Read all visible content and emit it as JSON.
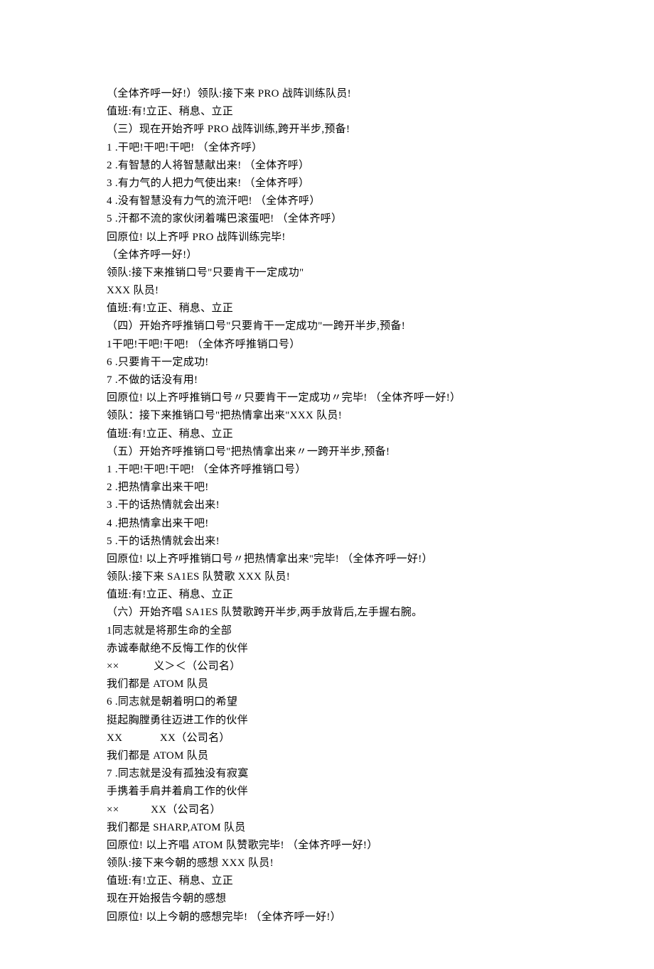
{
  "lines": [
    "（全体齐呼一好!）领队:接下来 PRO 战阵训练队员!",
    "值班:有!立正、稍息、立正",
    "（三）现在开始齐呼 PRO 战阵训练,跨开半步,预备!",
    "1 .干吧!干吧!干吧! （全体齐呼）",
    "2 .有智慧的人将智慧献出来! （全体齐呼）",
    "3 .有力气的人把力气使出来! （全体齐呼）",
    "4 .没有智慧没有力气的流汗吧! （全体齐呼）",
    "5 .汗都不流的家伙闭着嘴巴滚蛋吧! （全体齐呼）",
    "回原位! 以上齐呼 PRO 战阵训练完毕!",
    "（全体齐呼一好!）",
    "领队:接下来推销口号\"只要肯干一定成功\"",
    "XXX 队员!",
    "值班:有!立正、稍息、立正",
    "（四）开始齐呼推销口号\"只要肯干一定成功\"一跨开半步,预备!",
    "1干吧!干吧!干吧! （全体齐呼推销口号）",
    "6 .只要肯干一定成功!",
    "7 .不做的话没有用!",
    "回原位! 以上齐呼推销口号〃只要肯干一定成功〃完毕! （全体齐呼一好!）",
    "领队：接下来推销口号\"把热情拿出来\"XXX 队员!",
    "值班:有!立正、稍息、立正",
    "（五）开始齐呼推销口号\"把热情拿出来〃一跨开半步,预备!",
    "1 .干吧!干吧!干吧! （全体齐呼推销口号）",
    "2 .把热情拿出来干吧!",
    "3 .干的话热情就会出来!",
    "4 .把热情拿出来干吧!",
    "5 .干的话热情就会出来!",
    "回原位! 以上齐呼推销口号〃把热情拿出来\"完毕! （全体齐呼一好!）",
    "领队:接下来 SA1ES 队赞歌 XXX 队员!",
    "值班:有!立正、稍息、立正",
    "（六）开始齐唱 SA1ES 队赞歌跨开半步,两手放背后,左手握右腕。",
    "1同志就是将那生命的全部",
    "赤诚奉献绝不反悔工作的伙伴",
    "××            义＞＜（公司名）",
    "我们都是 ATOM 队员",
    "6 .同志就是朝着明口的希望",
    "挺起胸膛勇往迈进工作的伙伴",
    "XX             XX（公司名）",
    "我们都是 ATOM 队员",
    "7 .同志就是没有孤独没有寂寞",
    "手携着手肩并着肩工作的伙伴",
    "××           XX（公司名）",
    "我们都是 SHARP,ATOM 队员",
    "回原位! 以上齐唱 ATOM 队赞歌完毕! （全体齐呼一好!）",
    "领队:接下来今朝的感想 XXX 队员!",
    "值班:有!立正、稍息、立正",
    "现在开始报告今朝的感想",
    "回原位! 以上今朝的感想完毕! （全体齐呼一好!）"
  ]
}
